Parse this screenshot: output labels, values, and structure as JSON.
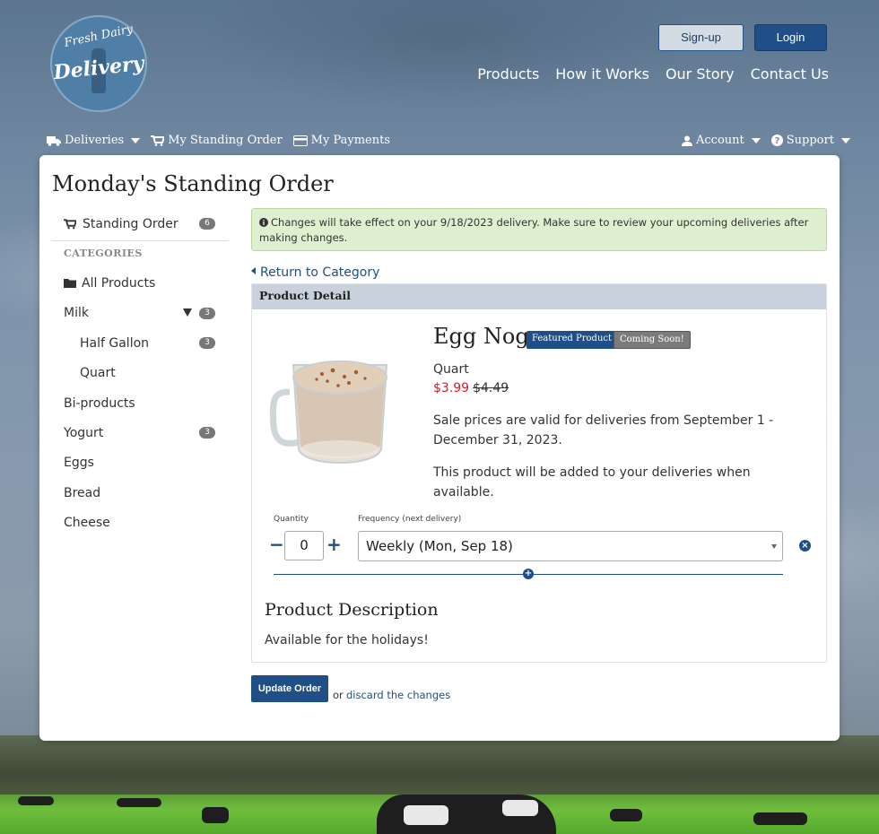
{
  "brand": {
    "line1": "Fresh Dairy",
    "line2": "Delivery"
  },
  "header": {
    "signup_label": "Sign-up",
    "login_label": "Login",
    "nav": [
      "Products",
      "How it Works",
      "Our Story",
      "Contact Us"
    ]
  },
  "subnav": {
    "deliveries": "Deliveries",
    "standing_order": "My Standing Order",
    "payments": "My Payments",
    "account": "Account",
    "support": "Support"
  },
  "page": {
    "title": "Monday's Standing Order"
  },
  "sidebar": {
    "standing_order": {
      "label": "Standing Order",
      "count": "6"
    },
    "categories_heading": "CATEGORIES",
    "items": [
      {
        "label": "All Products"
      },
      {
        "label": "Milk",
        "count": "3"
      },
      {
        "label": "Half Gallon",
        "count": "3"
      },
      {
        "label": "Quart"
      },
      {
        "label": "Bi-products"
      },
      {
        "label": "Yogurt",
        "count": "3"
      },
      {
        "label": "Eggs"
      },
      {
        "label": "Bread"
      },
      {
        "label": "Cheese"
      }
    ]
  },
  "notice": "Changes will take effect on your 9/18/2023 delivery. Make sure to review your upcoming deliveries after making changes.",
  "return_link": "Return to Category",
  "detail": {
    "heading": "Product Detail",
    "product_name": "Egg Nog",
    "tag_featured": "Featured Product",
    "tag_soon": "Coming Soon!",
    "size": "Quart",
    "sale_price": "$3.99",
    "original_price": "$4.49",
    "sale_note": "Sale prices are valid for deliveries from September 1 - December 31, 2023.",
    "availability_note": "This product will be added to your deliveries when available.",
    "quantity_label": "Quantity",
    "quantity_value": "0",
    "frequency_label": "Frequency (next delivery)",
    "frequency_value": "Weekly (Mon, Sep 18)",
    "description_heading": "Product Description",
    "description_text": "Available for the holidays!"
  },
  "actions": {
    "update_label": "Update Order",
    "or_text": "or",
    "discard_label": "discard the changes"
  },
  "colors": {
    "primary": "#1f4f86",
    "sale": "#d21f2a",
    "notice_bg": "#dff0d0"
  }
}
